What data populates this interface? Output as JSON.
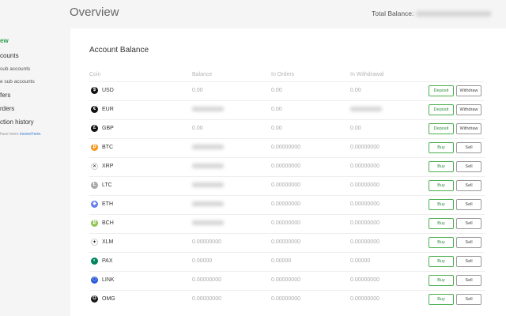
{
  "sidebar": {
    "items": [
      {
        "label": "ew"
      },
      {
        "label": "counts"
      },
      {
        "label": "sub accounts"
      },
      {
        "label": "e sub accounts"
      },
      {
        "label": "fers"
      },
      {
        "label": "rders"
      },
      {
        "label": "ction history"
      }
    ],
    "note": "have been",
    "note_link": "moved here."
  },
  "header": {
    "title": "Overview",
    "total_balance_label": "Total Balance:"
  },
  "card": {
    "title": "Account Balance",
    "columns": [
      "Coin",
      "Balance",
      "In Orders",
      "In Withdrawal"
    ]
  },
  "rows": [
    {
      "coin": "USD",
      "icon": "dollar-icon",
      "color": "#111111",
      "glyph": "$",
      "balance": "0.00",
      "orders": "0.00",
      "withdraw": "0.00",
      "btn1": "Deposit",
      "btn2": "Withdraw"
    },
    {
      "coin": "EUR",
      "icon": "euro-icon",
      "color": "#111111",
      "glyph": "€",
      "balance": "",
      "orders": "0.00",
      "withdraw": "",
      "btn1": "Deposit",
      "btn2": "Withdraw"
    },
    {
      "coin": "GBP",
      "icon": "pound-icon",
      "color": "#111111",
      "glyph": "£",
      "balance": "0.00",
      "orders": "0.00",
      "withdraw": "0.00",
      "btn1": "Deposit",
      "btn2": "Withdraw"
    },
    {
      "coin": "BTC",
      "icon": "bitcoin-icon",
      "color": "#f7931a",
      "glyph": "₿",
      "balance": "",
      "orders": "0.00000000",
      "withdraw": "0.00000000",
      "btn1": "Buy",
      "btn2": "Sell"
    },
    {
      "coin": "XRP",
      "icon": "xrp-icon",
      "color": "#ffffff",
      "glyph": "✕",
      "balance": "",
      "orders": "0.00000000",
      "withdraw": "0.00000000",
      "btn1": "Buy",
      "btn2": "Sell"
    },
    {
      "coin": "LTC",
      "icon": "litecoin-icon",
      "color": "#a6a9aa",
      "glyph": "Ł",
      "balance": "",
      "orders": "0.00000000",
      "withdraw": "0.00000000",
      "btn1": "Buy",
      "btn2": "Sell"
    },
    {
      "coin": "ETH",
      "icon": "ethereum-icon",
      "color": "#627eea",
      "glyph": "◆",
      "balance": "",
      "orders": "0.00000000",
      "withdraw": "0.00000000",
      "btn1": "Buy",
      "btn2": "Sell"
    },
    {
      "coin": "BCH",
      "icon": "bitcoin-cash-icon",
      "color": "#8dc351",
      "glyph": "₿",
      "balance": "",
      "orders": "0.00000000",
      "withdraw": "0.00000000",
      "btn1": "Buy",
      "btn2": "Sell"
    },
    {
      "coin": "XLM",
      "icon": "stellar-icon",
      "color": "#ffffff",
      "glyph": "✦",
      "balance": "0.00000000",
      "orders": "0.00000000",
      "withdraw": "0.00000000",
      "btn1": "Buy",
      "btn2": "Sell"
    },
    {
      "coin": "PAX",
      "icon": "pax-icon",
      "color": "#00845d",
      "glyph": "◐",
      "balance": "0.00000",
      "orders": "0.00000",
      "withdraw": "0.00000",
      "btn1": "Buy",
      "btn2": "Sell"
    },
    {
      "coin": "LINK",
      "icon": "chainlink-icon",
      "color": "#2a5ada",
      "glyph": "⬡",
      "balance": "0.00000000",
      "orders": "0.00000000",
      "withdraw": "0.00000000",
      "btn1": "Buy",
      "btn2": "Sell"
    },
    {
      "coin": "OMG",
      "icon": "omg-icon",
      "color": "#1a1a1a",
      "glyph": "O",
      "balance": "0.00000000",
      "orders": "0.00000000",
      "withdraw": "0.00000000",
      "btn1": "Buy",
      "btn2": "Sell"
    }
  ]
}
